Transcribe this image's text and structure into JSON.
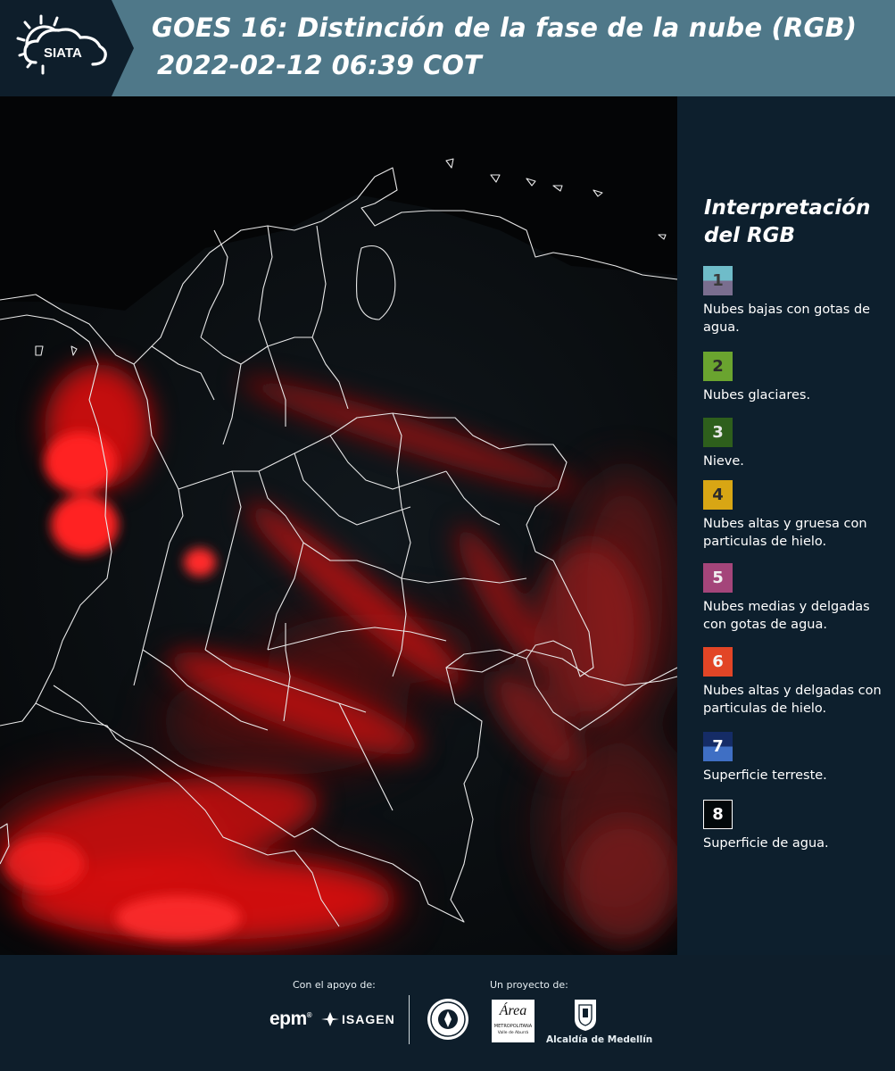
{
  "header": {
    "logo_text": "SIATA",
    "title_line1": "GOES 16: Distinción de la fase de la nube (RGB)",
    "title_line2": "2022-02-12 06:39 COT"
  },
  "legend": {
    "title_line1": "Interpretación",
    "title_line2": "del RGB",
    "items": [
      {
        "num": "1",
        "text": "Nubes bajas con gotas de agua.",
        "color_top": "#6fbcc9",
        "color_bottom": "#7a6e8f",
        "num_color": "#3a3a3a"
      },
      {
        "num": "2",
        "text": "Nubes glaciares.",
        "color_top": "#6aa42f",
        "color_bottom": "#6aa42f",
        "num_color": "#2b2b2b"
      },
      {
        "num": "3",
        "text": "Nieve.",
        "color_top": "#2e5f1c",
        "color_bottom": "#2e5f1c",
        "num_color": "#e8e8e8"
      },
      {
        "num": "4",
        "text": "Nubes altas y gruesa con particulas de hielo.",
        "color_top": "#d8a614",
        "color_bottom": "#d8a614",
        "num_color": "#2b2b2b"
      },
      {
        "num": "5",
        "text": "Nubes medias y delgadas con gotas de agua.",
        "color_top": "#a4457a",
        "color_bottom": "#a4457a",
        "num_color": "#f0f0f0"
      },
      {
        "num": "6",
        "text": "Nubes altas y delgadas con particulas de hielo.",
        "color_top": "#e24526",
        "color_bottom": "#e24526",
        "num_color": "#f5f5f5"
      },
      {
        "num": "7",
        "text": "Superficie terreste.",
        "color_top": "#152c66",
        "color_bottom": "#3f6fc4",
        "num_color": "#ffffff"
      },
      {
        "num": "8",
        "text": "Superficie de agua.",
        "color_top": "#02080a",
        "color_bottom": "#02080a",
        "num_color": "#ffffff"
      }
    ]
  },
  "footer": {
    "support_label": "Con el apoyo de:",
    "project_label": "Un proyecto de:",
    "sponsor_epm": "epm",
    "sponsor_isagen": "ISAGEN",
    "partner_metropolitana": "METROPOLITANA",
    "partner_metropolitana_sub": "Valle de Aburrá",
    "partner_area": "Área",
    "partner_alcaldia": "Alcaldía de Medellín"
  },
  "colors": {
    "header_bg": "#4f7889",
    "logo_bg": "#0e1e2b",
    "panel_bg": "#0d1f2d",
    "cloud_red": "#ff1a1a"
  }
}
